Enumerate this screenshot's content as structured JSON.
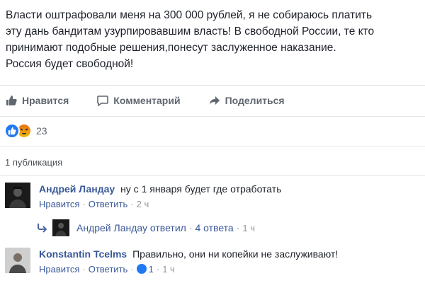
{
  "post": {
    "text_lines": [
      "Власти оштрафовали меня на 300 000 рублей, я не собираюсь платить",
      "эту дань бандитам узурпировавшим власть! В свободной России, те кто",
      "принимают подобные решения,понесут заслуженное наказание.",
      "Россия будет свободной!"
    ]
  },
  "actions": {
    "like": "Нравится",
    "comment": "Комментарий",
    "share": "Поделиться"
  },
  "reactions": {
    "types": [
      "like-icon",
      "angry-icon"
    ],
    "count": "23"
  },
  "publications_label": "1 публикация",
  "comments": [
    {
      "author": "Андрей Ландау",
      "text": "ну с 1 января будет где отработать",
      "like_label": "Нравится",
      "reply_label": "Ответить",
      "time": "2 ч",
      "replies_summary": {
        "text": "Андрей Ландау ответил",
        "count": "4 ответа",
        "time": "1 ч"
      }
    },
    {
      "author": "Konstantin Tcelms",
      "text": "Правильно, они ни копейки не заслуживают!",
      "like_label": "Нравится",
      "reply_label": "Ответить",
      "likes": "1",
      "time": "1 ч"
    }
  ],
  "colors": {
    "link": "#385898",
    "action_gray": "#606770",
    "like_blue": "#2078f4"
  }
}
